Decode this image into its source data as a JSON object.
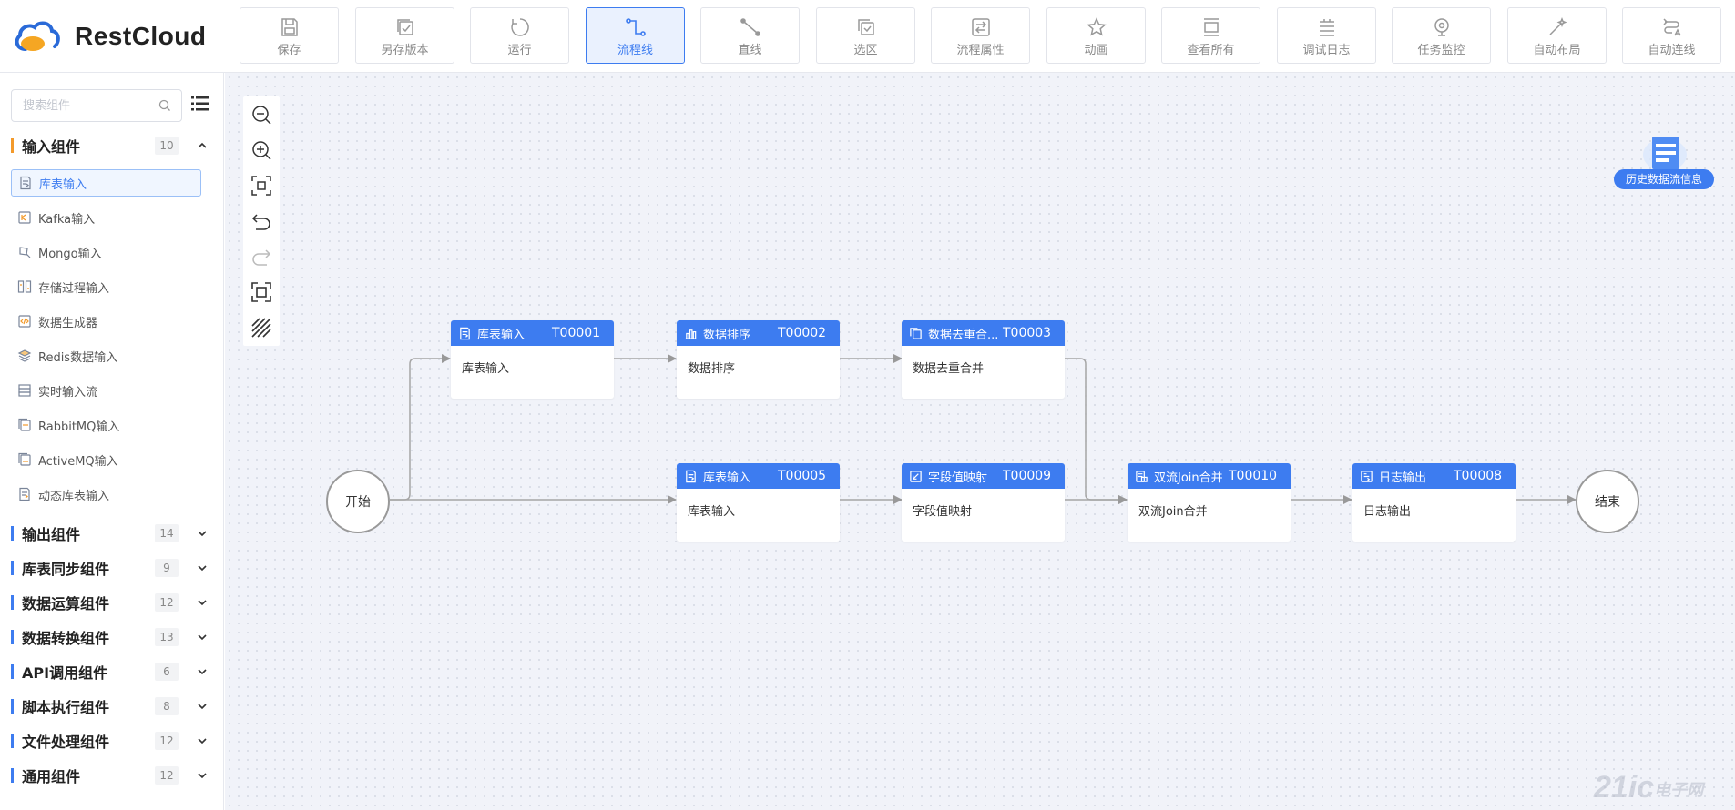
{
  "app": {
    "logo_text": "RestCloud"
  },
  "toolbar": [
    {
      "label": "保存",
      "icon": "save-icon"
    },
    {
      "label": "另存版本",
      "icon": "save-version-icon"
    },
    {
      "label": "运行",
      "icon": "run-icon"
    },
    {
      "label": "流程线",
      "icon": "flow-line-icon",
      "active": true
    },
    {
      "label": "直线",
      "icon": "straight-line-icon"
    },
    {
      "label": "选区",
      "icon": "selection-icon"
    },
    {
      "label": "流程属性",
      "icon": "flow-properties-icon"
    },
    {
      "label": "动画",
      "icon": "animation-icon"
    },
    {
      "label": "查看所有",
      "icon": "view-all-icon"
    },
    {
      "label": "调试日志",
      "icon": "debug-log-icon"
    },
    {
      "label": "任务监控",
      "icon": "task-monitor-icon"
    },
    {
      "label": "自动布局",
      "icon": "auto-layout-icon"
    },
    {
      "label": "自动连线",
      "icon": "auto-connect-icon"
    }
  ],
  "sidebar": {
    "search_placeholder": "搜索组件",
    "expanded_category": {
      "name": "输入组件",
      "count": "10"
    },
    "items": [
      {
        "label": "库表输入",
        "icon": "table-input-icon",
        "selected": true
      },
      {
        "label": "Kafka输入",
        "icon": "kafka-icon"
      },
      {
        "label": "Mongo输入",
        "icon": "mongo-icon"
      },
      {
        "label": "存储过程输入",
        "icon": "procedure-icon"
      },
      {
        "label": "数据生成器",
        "icon": "generator-icon"
      },
      {
        "label": "Redis数据输入",
        "icon": "redis-icon"
      },
      {
        "label": "实时输入流",
        "icon": "stream-icon"
      },
      {
        "label": "RabbitMQ输入",
        "icon": "rabbitmq-icon"
      },
      {
        "label": "ActiveMQ输入",
        "icon": "activemq-icon"
      },
      {
        "label": "动态库表输入",
        "icon": "dynamic-table-icon"
      }
    ],
    "categories": [
      {
        "name": "输出组件",
        "count": "14"
      },
      {
        "name": "库表同步组件",
        "count": "9"
      },
      {
        "name": "数据运算组件",
        "count": "12"
      },
      {
        "name": "数据转换组件",
        "count": "13"
      },
      {
        "name": "API调用组件",
        "count": "6"
      },
      {
        "name": "脚本执行组件",
        "count": "8"
      },
      {
        "name": "文件处理组件",
        "count": "12"
      },
      {
        "name": "通用组件",
        "count": "12"
      }
    ]
  },
  "canvas": {
    "tools": [
      "zoom-out-icon",
      "zoom-in-icon",
      "fit-view-icon",
      "undo-icon",
      "redo-icon",
      "fullscreen-icon",
      "grid-icon"
    ],
    "start_label": "开始",
    "end_label": "结束",
    "nodes": [
      {
        "title": "库表输入",
        "id": "T00001",
        "body": "库表输入",
        "icon": "table-input-icon"
      },
      {
        "title": "数据排序",
        "id": "T00002",
        "body": "数据排序",
        "icon": "bar-chart-icon"
      },
      {
        "title": "数据去重合...",
        "id": "T00003",
        "body": "数据去重合并",
        "icon": "copy-icon"
      },
      {
        "title": "库表输入",
        "id": "T00005",
        "body": "库表输入",
        "icon": "table-input-icon"
      },
      {
        "title": "字段值映射",
        "id": "T00009",
        "body": "字段值映射",
        "icon": "mapping-icon"
      },
      {
        "title": "双流Join合并",
        "id": "T00010",
        "body": "双流Join合并",
        "icon": "join-icon"
      },
      {
        "title": "日志输出",
        "id": "T00008",
        "body": "日志输出",
        "icon": "log-output-icon"
      }
    ],
    "history_label": "历史数据流信息"
  },
  "watermark": {
    "main": "21ic",
    "sub": "电子网"
  },
  "colors": {
    "accent": "#3d7cf0",
    "canvas_bg": "#f1f3f9"
  }
}
